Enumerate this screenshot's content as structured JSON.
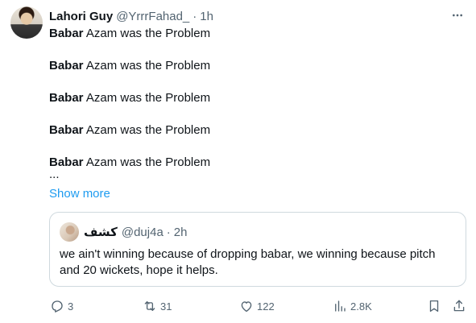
{
  "author": {
    "display_name": "Lahori Guy",
    "handle": "@YrrrFahad_",
    "separator": "·",
    "time": "1h"
  },
  "tweet": {
    "lines": [
      {
        "bold": "Babar",
        "rest": " Azam was the Problem"
      },
      {
        "bold": "Babar",
        "rest": " Azam was the Problem"
      },
      {
        "bold": "Babar",
        "rest": " Azam was the Problem"
      },
      {
        "bold": "Babar",
        "rest": " Azam was the Problem"
      },
      {
        "bold": "Babar",
        "rest": " Azam was the Problem"
      }
    ],
    "ellipsis": "...",
    "show_more": "Show more"
  },
  "quote": {
    "display_name": "كشف",
    "handle": "@duj4a",
    "separator": "·",
    "time": "2h",
    "text": "we ain't winning because of dropping babar, we winning because pitch and 20 wickets, hope it helps."
  },
  "actions": {
    "replies": "3",
    "reposts": "31",
    "likes": "122",
    "views": "2.8K"
  },
  "icons": {
    "more": "more-horizontal-icon",
    "reply": "reply-icon",
    "repost": "repost-icon",
    "like": "heart-icon",
    "views": "analytics-icon",
    "bookmark": "bookmark-icon",
    "share": "share-icon"
  },
  "colors": {
    "link": "#1d9bf0",
    "secondary_text": "#536471",
    "border": "#cfd9de"
  }
}
